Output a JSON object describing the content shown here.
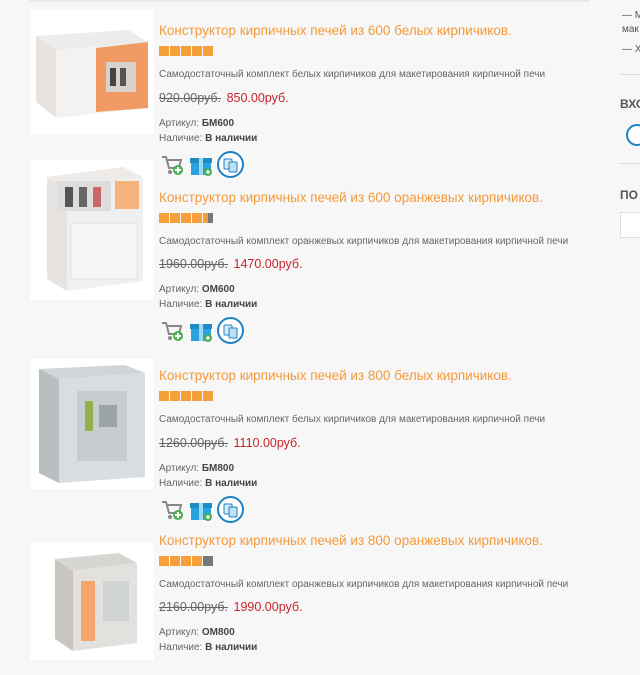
{
  "products": [
    {
      "title": "Конструктор кирпичных печей из 600 белых кирпичиков.",
      "rating": 5,
      "description": "Самодостаточный комплект белых кирпичиков для макетирования кирпичной печи",
      "old_price": "920.00руб.",
      "new_price": "850.00руб.",
      "sku_label": "Артикул: ",
      "sku": "БМ600",
      "stock_label": "Наличие: ",
      "stock": "В наличии"
    },
    {
      "title": "Конструктор кирпичных печей из 600 оранжевых кирпичиков.",
      "rating": 4.5,
      "description": "Самодостаточный комплект оранжевых кирпичиков для макетирования кирпичной печи",
      "old_price": "1960.00руб.",
      "new_price": "1470.00руб.",
      "sku_label": "Артикул: ",
      "sku": "ОМ600",
      "stock_label": "Наличие: ",
      "stock": "В наличии"
    },
    {
      "title": "Конструктор кирпичных печей из 800 белых кирпичиков.",
      "rating": 5,
      "description": "Самодостаточный комплект белых кирпичиков для макетирования кирпичной печи",
      "old_price": "1260.00руб.",
      "new_price": "1110.00руб.",
      "sku_label": "Артикул: ",
      "sku": "БМ800",
      "stock_label": "Наличие: ",
      "stock": "В наличии"
    },
    {
      "title": "Конструктор кирпичных печей из 800 оранжевых кирпичиков.",
      "rating": 4,
      "description": "Самодостаточный комплект оранжевых кирпичиков для макетирования кирпичной печи",
      "old_price": "2160.00руб.",
      "new_price": "1990.00руб.",
      "sku_label": "Артикул: ",
      "sku": "ОМ800",
      "stock_label": "Наличие: ",
      "stock": "В наличии"
    }
  ],
  "sidebar": {
    "line1": "— М",
    "line2": "мак",
    "line3": "— Х",
    "head1": "ВХО",
    "head2": "ПО"
  },
  "colors": {
    "title": "#f39a3c",
    "price_new": "#c8242b",
    "star": "#f6a03b"
  }
}
